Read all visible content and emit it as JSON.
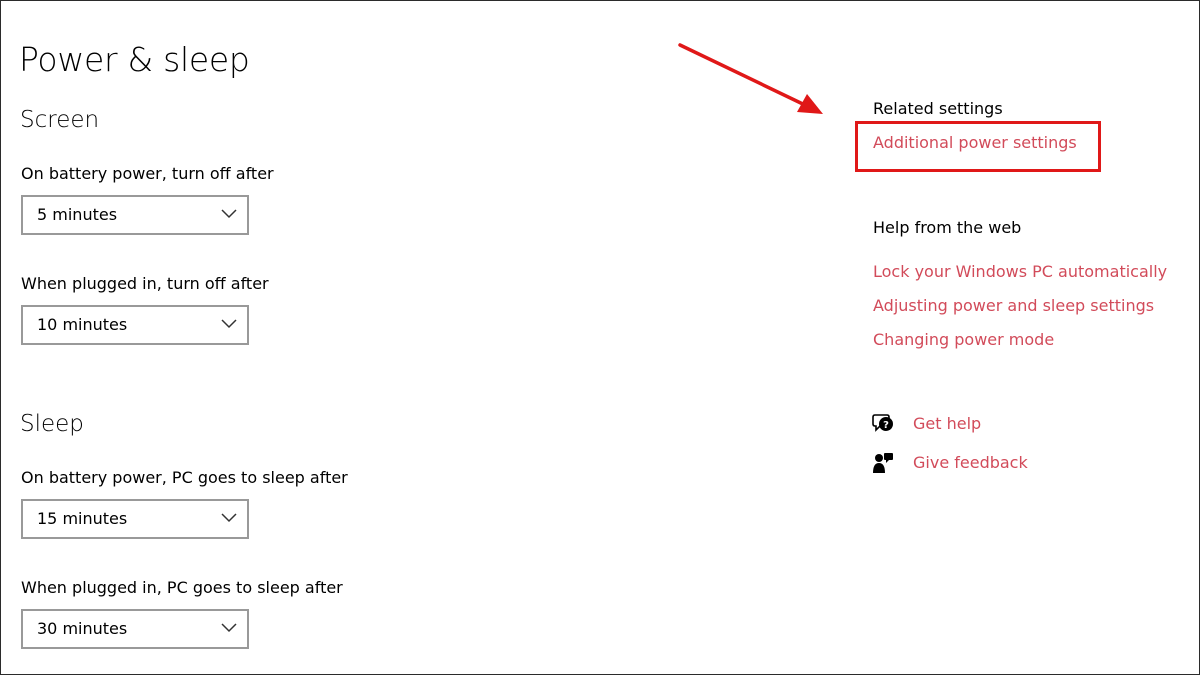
{
  "page": {
    "title": "Power & sleep"
  },
  "screen": {
    "heading": "Screen",
    "battery_label": "On battery power, turn off after",
    "battery_value": "5 minutes",
    "plugged_label": "When plugged in, turn off after",
    "plugged_value": "10 minutes"
  },
  "sleep": {
    "heading": "Sleep",
    "battery_label": "On battery power, PC goes to sleep after",
    "battery_value": "15 minutes",
    "plugged_label": "When plugged in, PC goes to sleep after",
    "plugged_value": "30 minutes"
  },
  "related": {
    "heading": "Related settings",
    "additional_power": "Additional power settings"
  },
  "web_help": {
    "heading": "Help from the web",
    "links": [
      "Lock your Windows PC automatically",
      "Adjusting power and sleep settings",
      "Changing power mode"
    ]
  },
  "support": {
    "get_help": "Get help",
    "give_feedback": "Give feedback"
  },
  "colors": {
    "link": "#d24b5a",
    "annotation": "#e01818",
    "dropdown_border": "#999999"
  },
  "icons": {
    "dropdown": "chevron-down-icon",
    "get_help": "help-chat-icon",
    "give_feedback": "feedback-person-icon",
    "annotation": "annotation-arrow-icon"
  }
}
